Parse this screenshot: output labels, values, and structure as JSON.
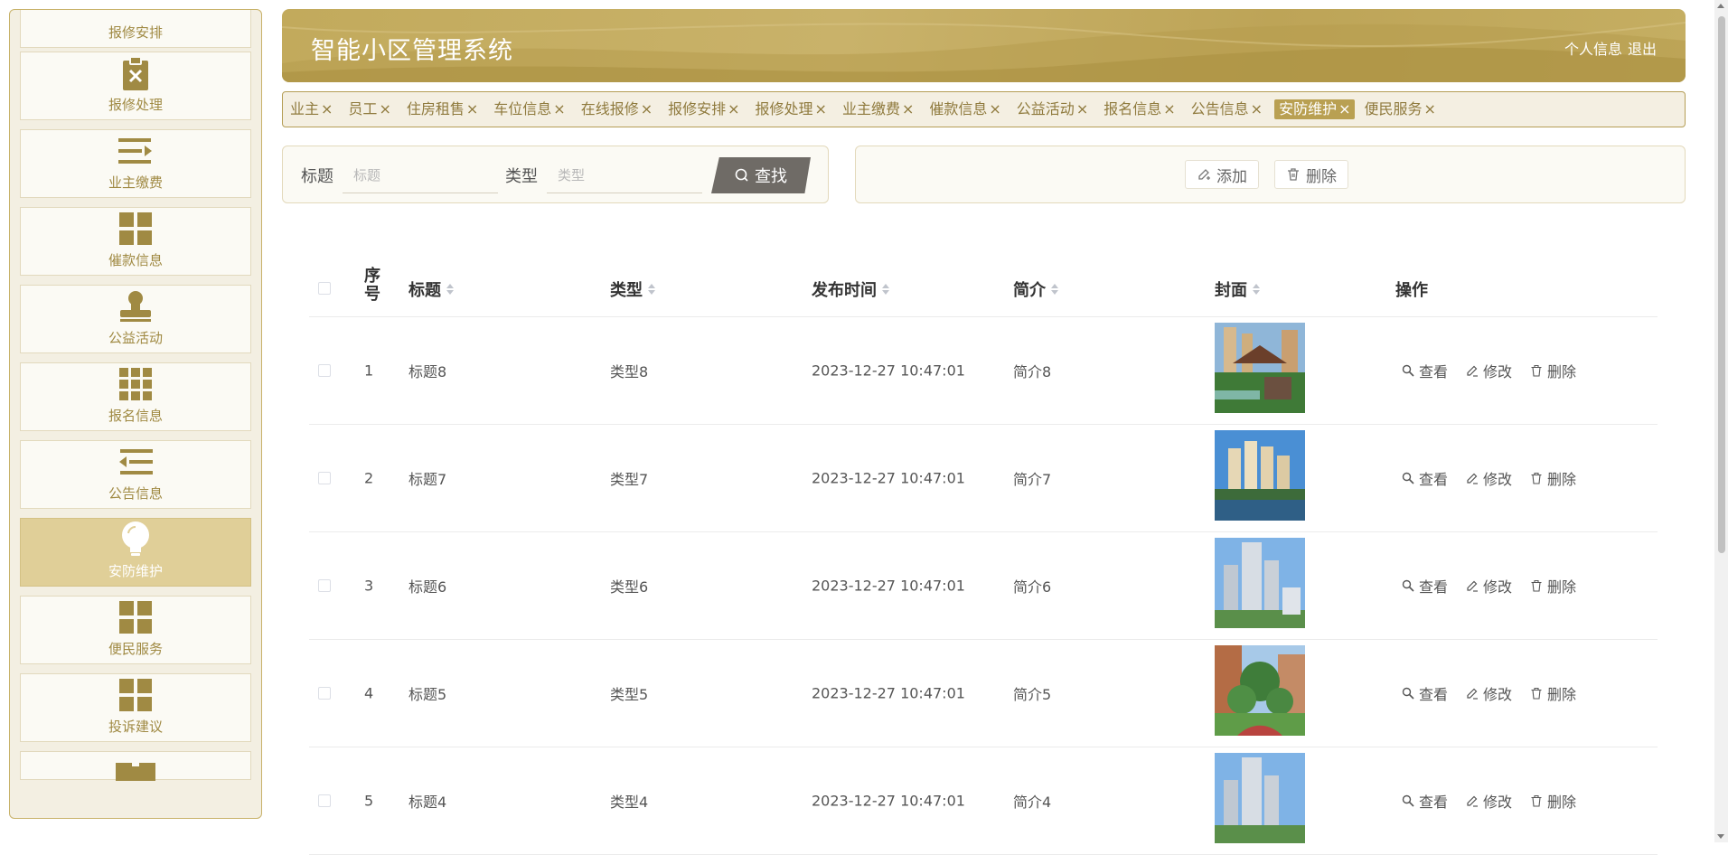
{
  "header": {
    "title": "智能小区管理系统",
    "profile_link": "个人信息",
    "logout_link": "退出"
  },
  "sidebar": {
    "items": [
      {
        "label": "报修安排",
        "icon": "calendar-icon"
      },
      {
        "label": "报修处理",
        "icon": "clipboard-x-icon"
      },
      {
        "label": "业主缴费",
        "icon": "list-arrow-icon"
      },
      {
        "label": "催款信息",
        "icon": "grid-icon"
      },
      {
        "label": "公益活动",
        "icon": "stamp-icon"
      },
      {
        "label": "报名信息",
        "icon": "grid-nine-icon"
      },
      {
        "label": "公告信息",
        "icon": "indent-icon"
      },
      {
        "label": "安防维护",
        "icon": "lightbulb-icon",
        "active": true
      },
      {
        "label": "便民服务",
        "icon": "grid-icon"
      },
      {
        "label": "投诉建议",
        "icon": "grid-icon"
      },
      {
        "label": "",
        "icon": "ticket-icon"
      }
    ]
  },
  "tabs": [
    {
      "label": "业主"
    },
    {
      "label": "员工"
    },
    {
      "label": "住房租售"
    },
    {
      "label": "车位信息"
    },
    {
      "label": "在线报修"
    },
    {
      "label": "报修安排"
    },
    {
      "label": "报修处理"
    },
    {
      "label": "业主缴费"
    },
    {
      "label": "催款信息"
    },
    {
      "label": "公益活动"
    },
    {
      "label": "报名信息"
    },
    {
      "label": "公告信息"
    },
    {
      "label": "安防维护",
      "active": true
    },
    {
      "label": "便民服务"
    }
  ],
  "search": {
    "title_label": "标题",
    "title_placeholder": "标题",
    "type_label": "类型",
    "type_placeholder": "类型",
    "search_button": "查找"
  },
  "actions": {
    "add": "添加",
    "delete": "删除"
  },
  "table": {
    "columns": {
      "index": "序号",
      "title": "标题",
      "type": "类型",
      "time": "发布时间",
      "intro": "简介",
      "cover": "封面",
      "ops": "操作"
    },
    "op_labels": {
      "view": "查看",
      "edit": "修改",
      "delete": "删除"
    },
    "rows": [
      {
        "index": "1",
        "title": "标题8",
        "type": "类型8",
        "time": "2023-12-27 10:47:01",
        "intro": "简介8"
      },
      {
        "index": "2",
        "title": "标题7",
        "type": "类型7",
        "time": "2023-12-27 10:47:01",
        "intro": "简介7"
      },
      {
        "index": "3",
        "title": "标题6",
        "type": "类型6",
        "time": "2023-12-27 10:47:01",
        "intro": "简介6"
      },
      {
        "index": "4",
        "title": "标题5",
        "type": "类型5",
        "time": "2023-12-27 10:47:01",
        "intro": "简介5"
      },
      {
        "index": "5",
        "title": "标题4",
        "type": "类型4",
        "time": "2023-12-27 10:47:01",
        "intro": "简介4"
      }
    ]
  },
  "colors": {
    "accent": "#b9a052",
    "header": "#c2aa5c",
    "sidebar_active": "#e0cf98"
  }
}
